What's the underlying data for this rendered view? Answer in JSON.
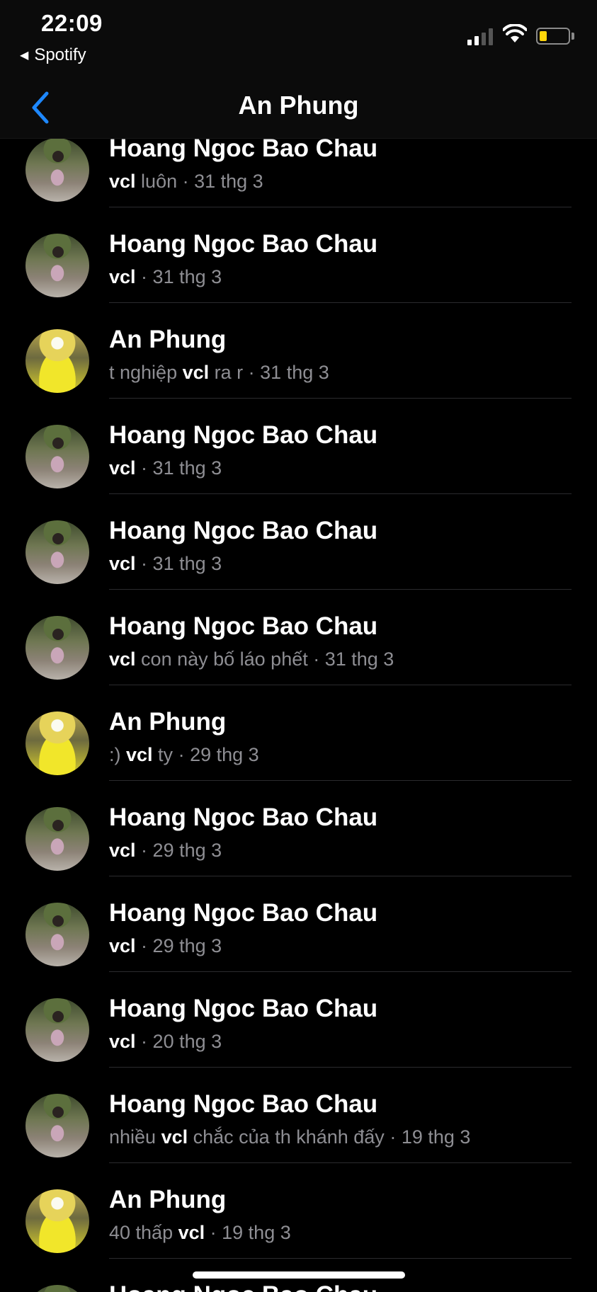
{
  "status_bar": {
    "time": "22:09",
    "back_app": "Spotify"
  },
  "nav": {
    "title": "An Phung"
  },
  "results": [
    {
      "name": "Hoang Ngoc Bao Chau",
      "avatar": "chau",
      "pre": "",
      "match": "vcl",
      "post": " luôn",
      "date": "31 thg 3"
    },
    {
      "name": "Hoang Ngoc Bao Chau",
      "avatar": "chau",
      "pre": "",
      "match": "vcl",
      "post": "",
      "date": "31 thg 3"
    },
    {
      "name": "An Phung",
      "avatar": "an",
      "pre": "t nghiệp ",
      "match": "vcl",
      "post": " ra r",
      "date": "31 thg 3"
    },
    {
      "name": "Hoang Ngoc Bao Chau",
      "avatar": "chau",
      "pre": "",
      "match": "vcl",
      "post": "",
      "date": "31 thg 3"
    },
    {
      "name": "Hoang Ngoc Bao Chau",
      "avatar": "chau",
      "pre": "",
      "match": "vcl",
      "post": "",
      "date": "31 thg 3"
    },
    {
      "name": "Hoang Ngoc Bao Chau",
      "avatar": "chau",
      "pre": "",
      "match": "vcl",
      "post": " con này bố láo phết",
      "date": "31 thg 3"
    },
    {
      "name": "An Phung",
      "avatar": "an",
      "pre": ":) ",
      "match": "vcl",
      "post": " ty",
      "date": "29 thg 3"
    },
    {
      "name": "Hoang Ngoc Bao Chau",
      "avatar": "chau",
      "pre": "",
      "match": "vcl",
      "post": "",
      "date": "29 thg 3"
    },
    {
      "name": "Hoang Ngoc Bao Chau",
      "avatar": "chau",
      "pre": "",
      "match": "vcl",
      "post": "",
      "date": "29 thg 3"
    },
    {
      "name": "Hoang Ngoc Bao Chau",
      "avatar": "chau",
      "pre": "",
      "match": "vcl",
      "post": "",
      "date": "20 thg 3"
    },
    {
      "name": "Hoang Ngoc Bao Chau",
      "avatar": "chau",
      "pre": "nhiều ",
      "match": "vcl",
      "post": " chắc của th khánh đấy",
      "date": "19 thg 3"
    },
    {
      "name": "An Phung",
      "avatar": "an",
      "pre": "40 thấp ",
      "match": "vcl",
      "post": "",
      "date": "19 thg 3"
    },
    {
      "name": "Hoang Ngoc Bao Chau",
      "avatar": "chau",
      "pre": "",
      "match": "",
      "post": "",
      "date": ""
    }
  ]
}
